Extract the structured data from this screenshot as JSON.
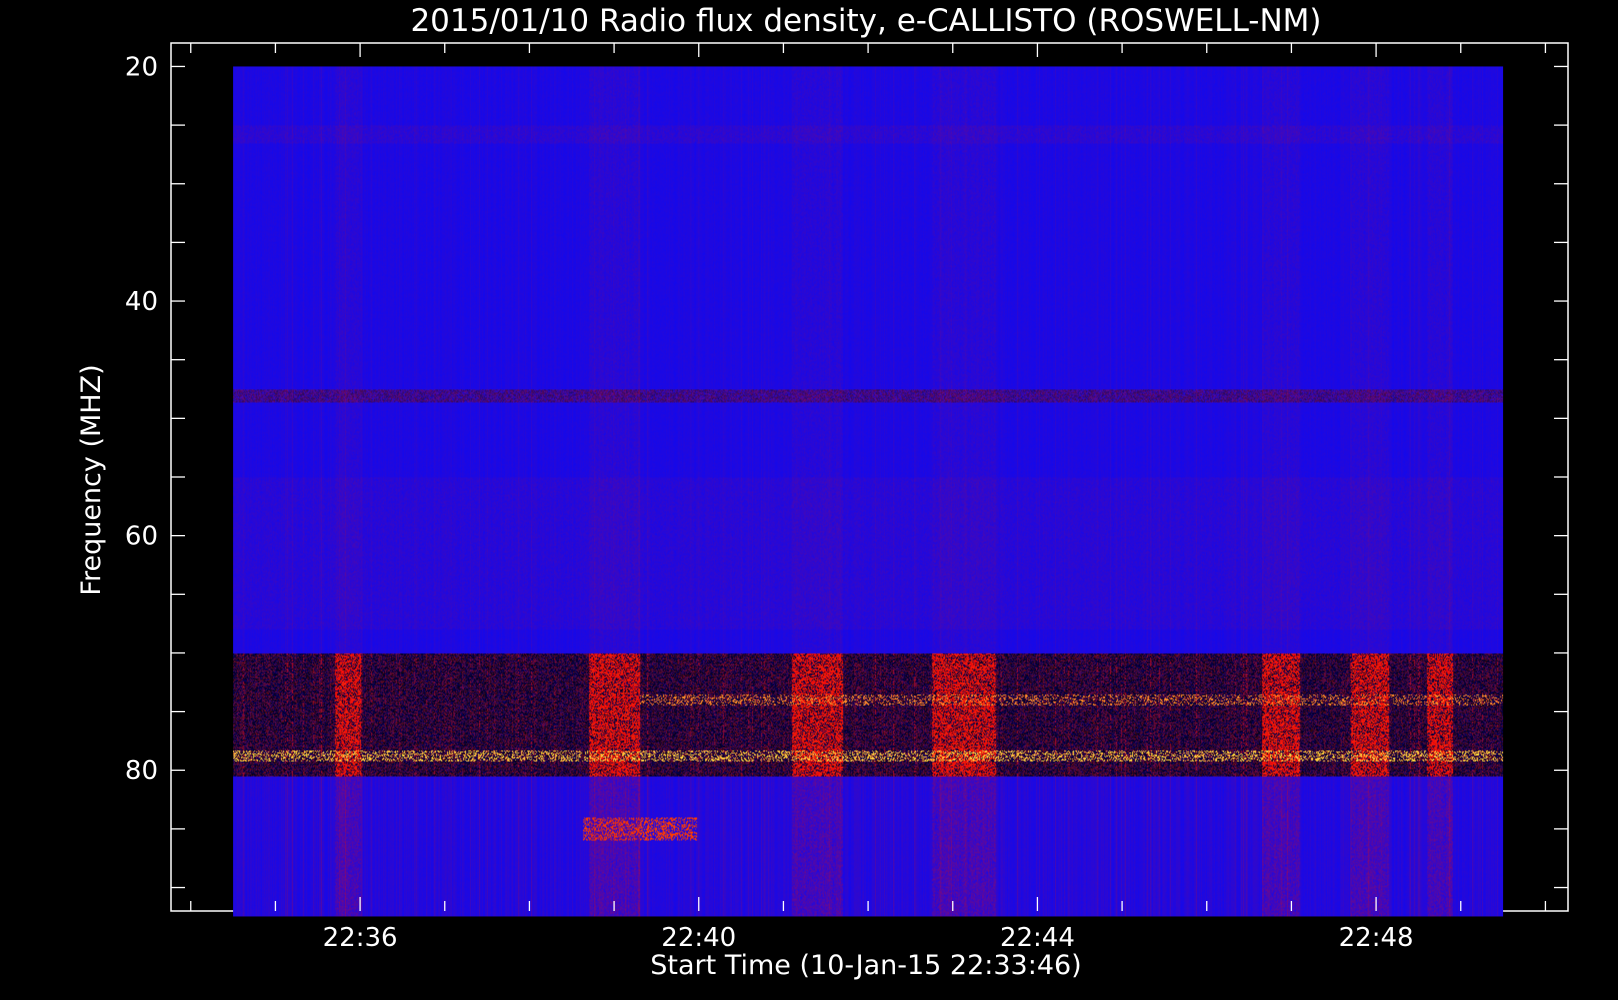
{
  "chart_data": {
    "type": "heatmap",
    "title": "2015/01/10  Radio flux density, e-CALLISTO (ROSWELL-NM)",
    "xlabel": "Start Time (10-Jan-15 22:33:46)",
    "ylabel": "Frequency (MHZ)",
    "y_axis_inverted": true,
    "ylim": [
      92,
      18
    ],
    "xlim_minutes": [
      "22:33:46",
      "22:50:16"
    ],
    "x_tick_labels": [
      "22:36",
      "22:40",
      "22:44",
      "22:48"
    ],
    "y_tick_labels": [
      "20",
      "40",
      "60",
      "80"
    ],
    "y_ticks": [
      20,
      40,
      60,
      80
    ],
    "data_time_range": [
      "22:34:30",
      "22:49:30"
    ],
    "data_freq_range": [
      20,
      92.5
    ],
    "colormap": [
      "#000000",
      "#0000ff",
      "#ff0000",
      "#ffff66"
    ],
    "background_color": "#1a10f0",
    "features": [
      {
        "freq_range": [
          47.5,
          48.5
        ],
        "description": "persistent horizontal interference line"
      },
      {
        "freq_range": [
          70,
          80
        ],
        "description": "interference band"
      },
      {
        "freq_range": [
          78,
          79
        ],
        "description": "intermittent bright interference"
      }
    ],
    "grid": false,
    "legend": "none"
  }
}
